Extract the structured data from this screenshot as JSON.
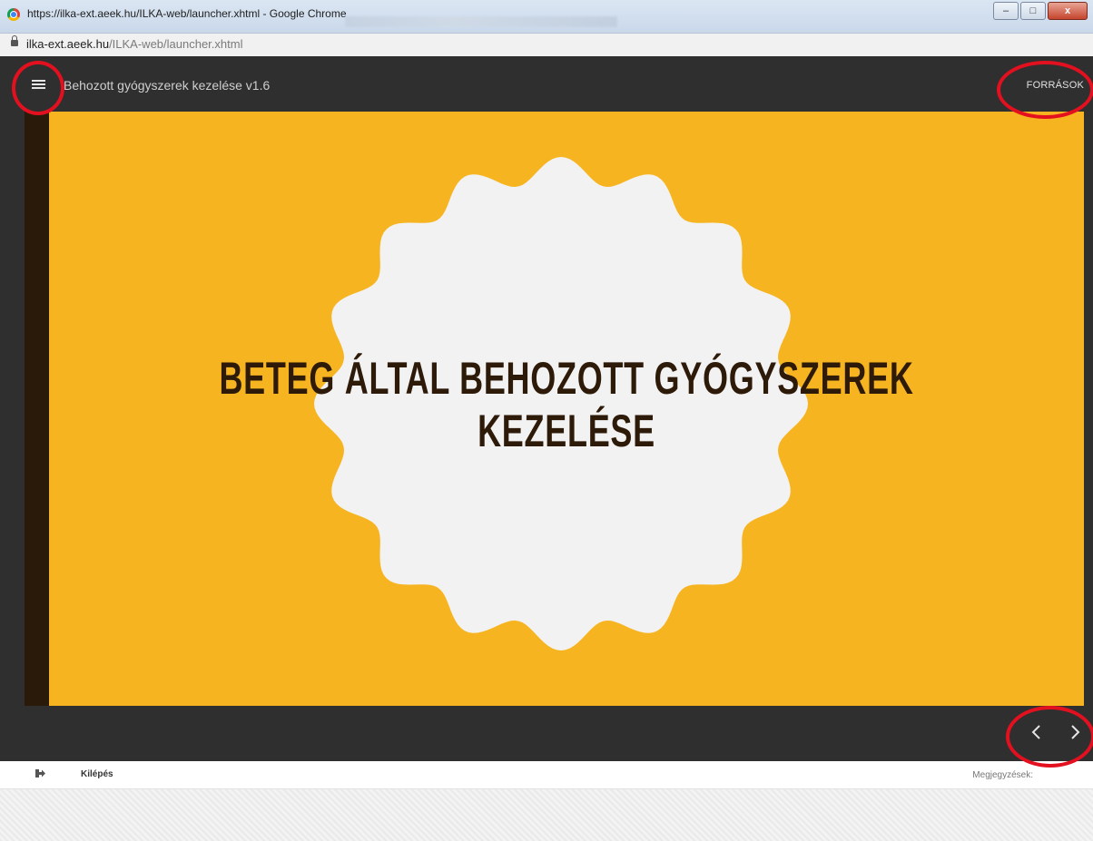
{
  "window": {
    "title": "https://ilka-ext.aeek.hu/ILKA-web/launcher.xhtml - Google Chrome",
    "controls": {
      "minimize": "–",
      "maximize": "□",
      "close": "x"
    }
  },
  "address_bar": {
    "host": "ilka-ext.aeek.hu",
    "path": "/ILKA-web/launcher.xhtml"
  },
  "header": {
    "title": "Behozott gyógyszerek kezelése v1.6",
    "sources_label": "FORRÁSOK"
  },
  "slide": {
    "title_line1": "BETEG ÁLTAL BEHOZOTT GYÓGYSZEREK",
    "title_line2": "KEZELÉSE"
  },
  "footer": {
    "exit_label": "Kilépés",
    "notes_label": "Megjegyzések:"
  },
  "icons": {
    "menu": "hamburger-menu-icon",
    "prev": "chevron-left-icon",
    "next": "chevron-right-icon",
    "exit": "exit-icon",
    "lock": "lock-icon"
  },
  "colors": {
    "slide_bg": "#f7b421",
    "badge": "#f2f2f2",
    "title_text": "#2d1a08",
    "app_bar": "#2f2f2f",
    "annotation": "#e3101f"
  }
}
